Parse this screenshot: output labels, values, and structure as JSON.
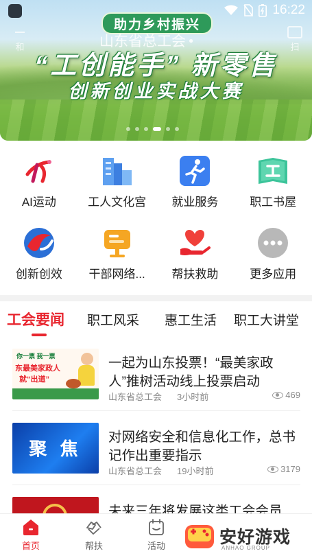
{
  "status_bar": {
    "time": "16:22"
  },
  "banner": {
    "pill_text": "助力乡村振兴",
    "org_selector": "山东省总工会",
    "left_side_text": "和",
    "right_side_text": "扫",
    "headline": "“工创能手” 新零售",
    "subheadline": "创新创业实战大赛",
    "dots_count": 6,
    "active_dot": 4
  },
  "services": [
    {
      "label": "AI运动",
      "icon": "ai-sport-icon"
    },
    {
      "label": "工人文化宫",
      "icon": "culture-palace-icon"
    },
    {
      "label": "就业服务",
      "icon": "employment-icon"
    },
    {
      "label": "职工书屋",
      "icon": "bookhouse-icon"
    },
    {
      "label": "创新创效",
      "icon": "innovation-icon"
    },
    {
      "label": "干部网络...",
      "icon": "cadre-network-icon"
    },
    {
      "label": "帮扶救助",
      "icon": "assistance-icon"
    },
    {
      "label": "更多应用",
      "icon": "more-apps-icon"
    }
  ],
  "tabs": [
    "工会要闻",
    "职工风采",
    "惠工生活",
    "职工大讲堂"
  ],
  "news": [
    {
      "title": "一起为山东投票！“最美家政人”推树活动线上投票启动",
      "source": "山东省总工会",
      "time": "3小时前",
      "views": "469",
      "thumb_line1": "你一票  我一票",
      "thumb_line2": "东最美家政人",
      "thumb_line3": "就“出道”"
    },
    {
      "title": "对网络安全和信息化工作，总书记作出重要指示",
      "source": "山东省总工会",
      "time": "19小时前",
      "views": "3179",
      "thumb_line1": "聚 焦"
    },
    {
      "title": "未来三年将发展这类工会会员",
      "source": "",
      "time": "",
      "views": ""
    }
  ],
  "bottom_nav": [
    {
      "label": "首页",
      "icon": "home-icon"
    },
    {
      "label": "帮扶",
      "icon": "help-hands-icon"
    },
    {
      "label": "活动",
      "icon": "activity-icon"
    }
  ],
  "watermark": {
    "text": "安好游戏",
    "sub": "ANHAO GROUP"
  },
  "colors": {
    "accent": "#e8262f",
    "banner_pill": "#2e9a5a"
  }
}
